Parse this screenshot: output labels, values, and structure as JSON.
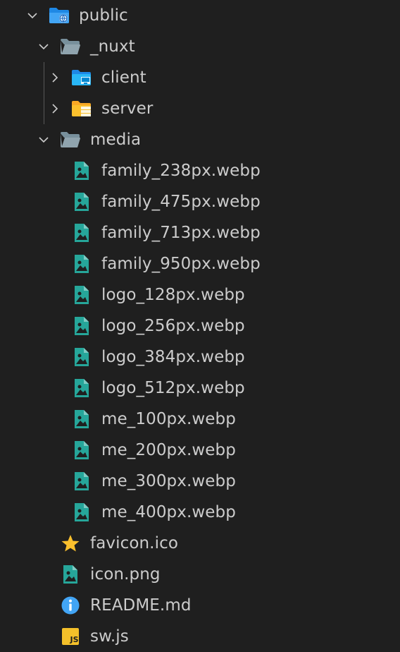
{
  "explorer": {
    "items": [
      {
        "label": "public",
        "type": "folder",
        "state": "expanded",
        "icon": "public-folder-icon"
      },
      {
        "label": "_nuxt",
        "type": "folder",
        "state": "expanded",
        "icon": "folder-open-icon"
      },
      {
        "label": "client",
        "type": "folder",
        "state": "collapsed",
        "icon": "client-folder-icon"
      },
      {
        "label": "server",
        "type": "folder",
        "state": "collapsed",
        "icon": "server-folder-icon"
      },
      {
        "label": "media",
        "type": "folder",
        "state": "expanded",
        "icon": "folder-open-icon"
      },
      {
        "label": "family_238px.webp",
        "type": "file",
        "icon": "image-file-icon"
      },
      {
        "label": "family_475px.webp",
        "type": "file",
        "icon": "image-file-icon"
      },
      {
        "label": "family_713px.webp",
        "type": "file",
        "icon": "image-file-icon"
      },
      {
        "label": "family_950px.webp",
        "type": "file",
        "icon": "image-file-icon"
      },
      {
        "label": "logo_128px.webp",
        "type": "file",
        "icon": "image-file-icon"
      },
      {
        "label": "logo_256px.webp",
        "type": "file",
        "icon": "image-file-icon"
      },
      {
        "label": "logo_384px.webp",
        "type": "file",
        "icon": "image-file-icon"
      },
      {
        "label": "logo_512px.webp",
        "type": "file",
        "icon": "image-file-icon"
      },
      {
        "label": "me_100px.webp",
        "type": "file",
        "icon": "image-file-icon"
      },
      {
        "label": "me_200px.webp",
        "type": "file",
        "icon": "image-file-icon"
      },
      {
        "label": "me_300px.webp",
        "type": "file",
        "icon": "image-file-icon"
      },
      {
        "label": "me_400px.webp",
        "type": "file",
        "icon": "image-file-icon"
      },
      {
        "label": "favicon.ico",
        "type": "file",
        "icon": "star-icon"
      },
      {
        "label": "icon.png",
        "type": "file",
        "icon": "image-file-icon"
      },
      {
        "label": "README.md",
        "type": "file",
        "icon": "info-icon"
      },
      {
        "label": "sw.js",
        "type": "file",
        "icon": "javascript-icon"
      }
    ]
  },
  "colors": {
    "background": "#1f1f1f",
    "text": "#cccccc",
    "image_icon": "#26a69a",
    "folder_icon": "#90a4ae",
    "client_folder": "#29b6f6",
    "server_folder": "#fbc02d",
    "star": "#fbc02d",
    "info": "#42a5f5",
    "js": "#f4c02a"
  }
}
